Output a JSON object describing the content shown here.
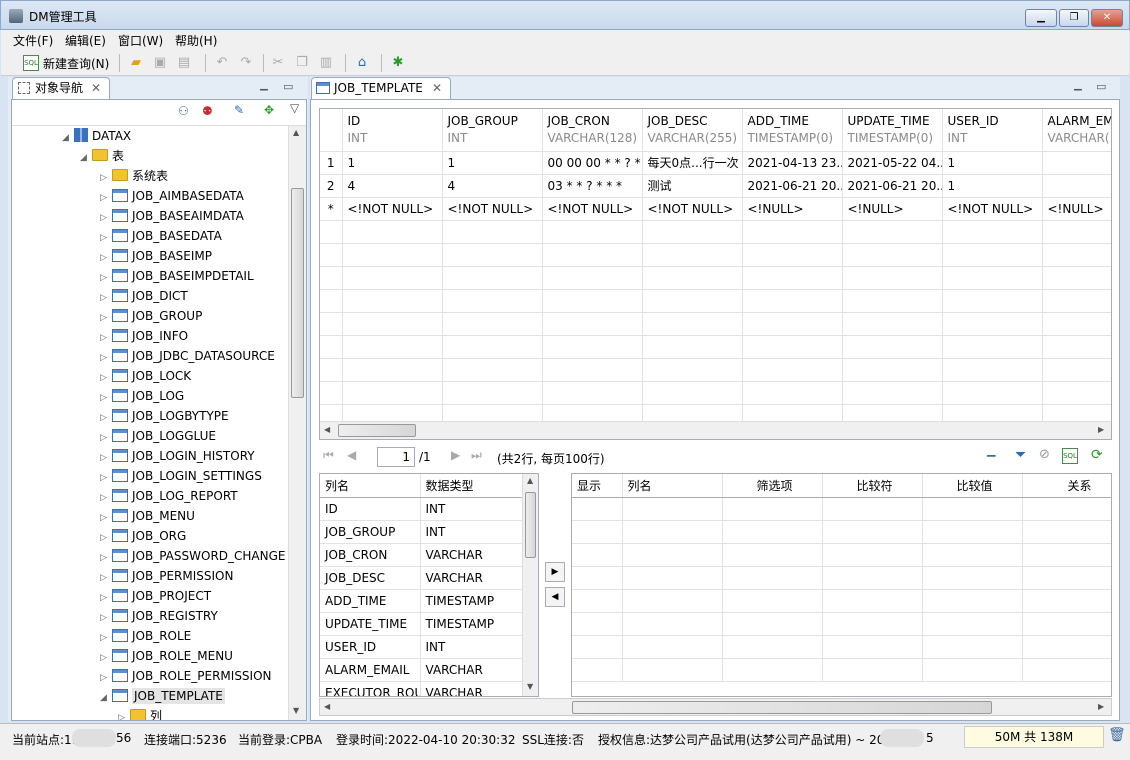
{
  "window": {
    "title": "DM管理工具",
    "min": "▁",
    "max": "❐",
    "close": "✕"
  },
  "menu": [
    "文件(F)",
    "编辑(E)",
    "窗口(W)",
    "帮助(H)"
  ],
  "toolbar": {
    "new_query": "新建查询(N)"
  },
  "nav": {
    "tab": "对象导航",
    "root": "DATAX",
    "folder": "表",
    "system_tables": "系统表",
    "tables": [
      "JOB_AIMBASEDATA",
      "JOB_BASEAIMDATA",
      "JOB_BASEDATA",
      "JOB_BASEIMP",
      "JOB_BASEIMPDETAIL",
      "JOB_DICT",
      "JOB_GROUP",
      "JOB_INFO",
      "JOB_JDBC_DATASOURCE",
      "JOB_LOCK",
      "JOB_LOG",
      "JOB_LOGBYTYPE",
      "JOB_LOGGLUE",
      "JOB_LOGIN_HISTORY",
      "JOB_LOGIN_SETTINGS",
      "JOB_LOG_REPORT",
      "JOB_MENU",
      "JOB_ORG",
      "JOB_PASSWORD_CHANGE",
      "JOB_PERMISSION",
      "JOB_PROJECT",
      "JOB_REGISTRY",
      "JOB_ROLE",
      "JOB_ROLE_MENU",
      "JOB_ROLE_PERMISSION",
      "JOB_TEMPLATE"
    ],
    "sub": "列"
  },
  "editor": {
    "tab": "JOB_TEMPLATE",
    "columns": [
      {
        "name": "ID",
        "type": "INT"
      },
      {
        "name": "JOB_GROUP",
        "type": "INT"
      },
      {
        "name": "JOB_CRON",
        "type": "VARCHAR(128)"
      },
      {
        "name": "JOB_DESC",
        "type": "VARCHAR(255)"
      },
      {
        "name": "ADD_TIME",
        "type": "TIMESTAMP(0)"
      },
      {
        "name": "UPDATE_TIME",
        "type": "TIMESTAMP(0)"
      },
      {
        "name": "USER_ID",
        "type": "INT"
      },
      {
        "name": "ALARM_EM",
        "type": "VARCHAR("
      }
    ],
    "rows": [
      {
        "num": "1",
        "cells": [
          "1",
          "1",
          "00 00 00 * * ? *",
          "每天0点...行一次",
          "2021-04-13 23...",
          "2021-05-22 04...",
          "1",
          ""
        ]
      },
      {
        "num": "2",
        "cells": [
          "4",
          "4",
          "03 * * ? * * *",
          "测试",
          "2021-06-21 20...",
          "2021-06-21 20...",
          "1",
          ""
        ]
      },
      {
        "num": "*",
        "cells": [
          "<!NOT NULL>",
          "<!NOT NULL>",
          "<!NOT NULL>",
          "<!NOT NULL>",
          "<!NULL>",
          "<!NULL>",
          "<!NOT NULL>",
          "<!NULL>"
        ]
      }
    ],
    "pager": {
      "page": "1",
      "total": "/1",
      "summary": "(共2行, 每页100行)"
    }
  },
  "filter": {
    "left_headers": [
      "列名",
      "数据类型"
    ],
    "left_rows": [
      [
        "ID",
        "INT"
      ],
      [
        "JOB_GROUP",
        "INT"
      ],
      [
        "JOB_CRON",
        "VARCHAR"
      ],
      [
        "JOB_DESC",
        "VARCHAR"
      ],
      [
        "ADD_TIME",
        "TIMESTAMP"
      ],
      [
        "UPDATE_TIME",
        "TIMESTAMP"
      ],
      [
        "USER_ID",
        "INT"
      ],
      [
        "ALARM_EMAIL",
        "VARCHAR"
      ],
      [
        "EXECUTOR_ROU",
        "VARCHAR"
      ]
    ],
    "right_headers": [
      "显示",
      "列名",
      "筛选项",
      "比较符",
      "比较值",
      "关系"
    ]
  },
  "status": {
    "site_label": "当前站点:19",
    "site_tail": "56",
    "port": "连接端口:5236",
    "login": "当前登录:CPBA",
    "login_time": "登录时间:2022-04-10 20:30:32",
    "ssl": "SSL连接:否",
    "license": "授权信息:达梦公司产品试用(达梦公司产品试用) ~ 20",
    "license_tail": "5",
    "memory": "50M 共 138M"
  }
}
